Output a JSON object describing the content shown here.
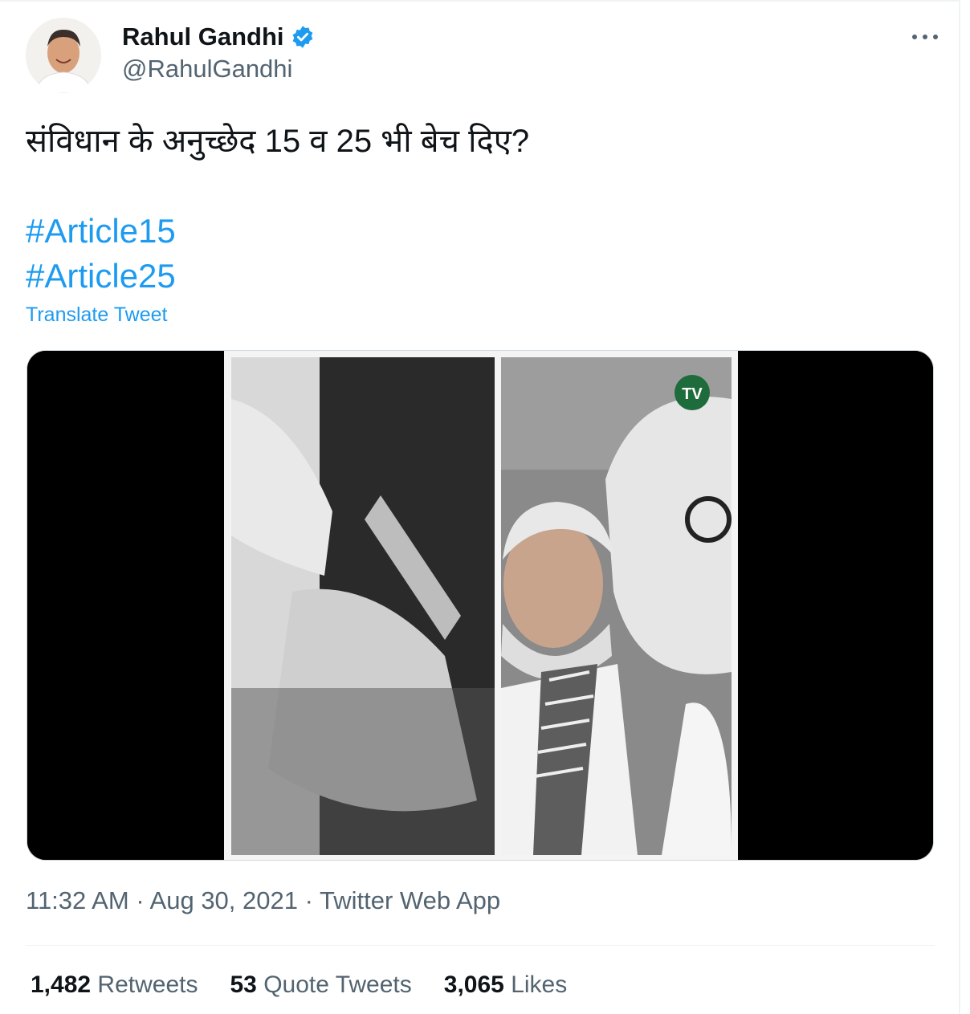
{
  "author": {
    "display_name": "Rahul Gandhi",
    "handle": "@RahulGandhi",
    "verified": true,
    "avatar_icon": "profile-photo"
  },
  "tweet": {
    "text": "संविधान के अनुच्छेद 15 व 25 भी बेच दिए?",
    "hashtags": [
      "#Article15",
      "#Article25"
    ],
    "translate_label": "Translate Tweet"
  },
  "media": {
    "type": "video-thumbnail",
    "watermark_icon": "tv-logo-icon"
  },
  "meta": {
    "time": "11:32 AM",
    "date": "Aug 30, 2021",
    "source": "Twitter Web App",
    "separator": "·"
  },
  "stats": {
    "retweets": {
      "count": "1,482",
      "label": "Retweets"
    },
    "quotes": {
      "count": "53",
      "label": "Quote Tweets"
    },
    "likes": {
      "count": "3,065",
      "label": "Likes"
    }
  },
  "colors": {
    "link": "#1d9bf0",
    "text": "#0f1419",
    "secondary": "#536471",
    "verified": "#1d9bf0"
  }
}
